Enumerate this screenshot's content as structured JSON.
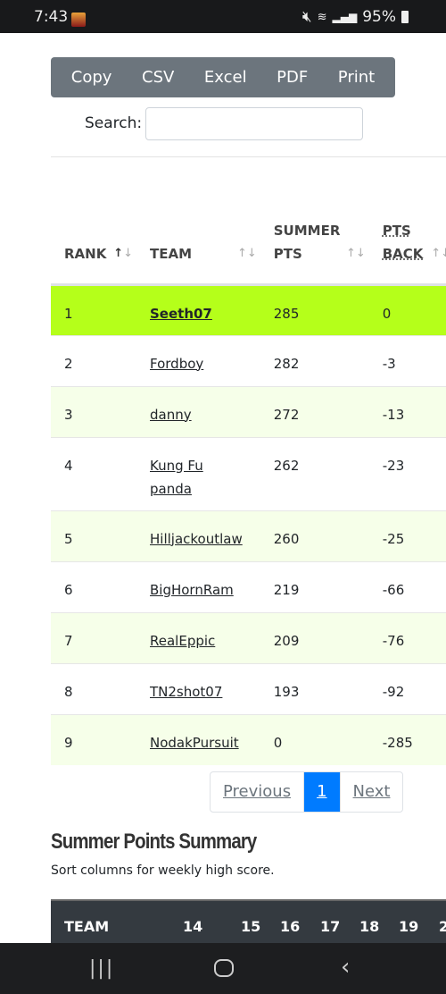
{
  "status": {
    "time": "7:43",
    "battery": "95%"
  },
  "toolbar": {
    "buttons": [
      "Copy",
      "CSV",
      "Excel",
      "PDF",
      "Print"
    ]
  },
  "search": {
    "label": "Search:",
    "value": ""
  },
  "table": {
    "headers": [
      {
        "line1": "",
        "line2": "RANK"
      },
      {
        "line1": "",
        "line2": "TEAM"
      },
      {
        "line1": "SUMMER",
        "line2": "PTS"
      },
      {
        "line1": "PTS",
        "line2": "BACK"
      }
    ],
    "rows": [
      {
        "rank": "1",
        "team": "Seeth07",
        "pts": "285",
        "back": "0"
      },
      {
        "rank": "2",
        "team": "Fordboy",
        "pts": "282",
        "back": "-3"
      },
      {
        "rank": "3",
        "team": "danny",
        "pts": "272",
        "back": "-13"
      },
      {
        "rank": "4",
        "team": "Kung Fu panda",
        "pts": "262",
        "back": "-23"
      },
      {
        "rank": "5",
        "team": "Hilljackoutlaw",
        "pts": "260",
        "back": "-25"
      },
      {
        "rank": "6",
        "team": "BigHornRam",
        "pts": "219",
        "back": "-66"
      },
      {
        "rank": "7",
        "team": "RealEppic",
        "pts": "209",
        "back": "-76"
      },
      {
        "rank": "8",
        "team": "TN2shot07",
        "pts": "193",
        "back": "-92"
      },
      {
        "rank": "9",
        "team": "NodakPursuit",
        "pts": "0",
        "back": "-285"
      }
    ],
    "highlight_color": "#b5ff1a"
  },
  "pagination": {
    "previous": "Previous",
    "current": "1",
    "next": "Next",
    "active_color": "#007bff"
  },
  "summary": {
    "title": "Summer Points Summary",
    "subtitle": "Sort columns for weekly high score.",
    "headers": [
      "TEAM",
      "14",
      "15",
      "16",
      "17",
      "18",
      "19",
      "2"
    ]
  }
}
